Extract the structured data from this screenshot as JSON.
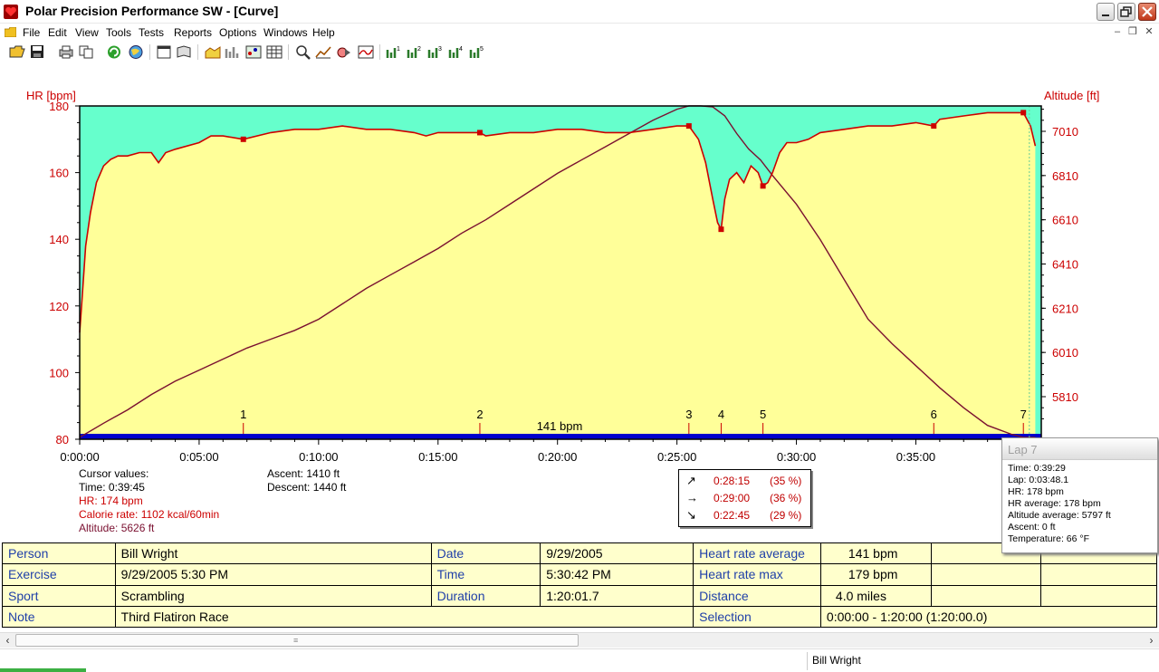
{
  "window": {
    "title": "Polar Precision Performance SW - [Curve]"
  },
  "menu": {
    "items": [
      "File",
      "Edit",
      "View",
      "Tools",
      "Tests",
      "Reports",
      "Options",
      "Windows",
      "Help"
    ]
  },
  "toolbar": {
    "icons": [
      "open-folder-icon",
      "save-icon",
      "print-icon",
      "copy-icon",
      "refresh-icon",
      "globe-icon",
      "window-icon",
      "book-icon",
      "area-chart-icon",
      "bar-chart-icon",
      "scatter-chart-icon",
      "table-grid-icon",
      "zoom-icon",
      "trend-icon",
      "compare-icon",
      "curve-icon",
      "chart-1-icon",
      "chart-2-icon",
      "chart-3-icon",
      "chart-4-icon",
      "chart-5-icon"
    ]
  },
  "chart_data": {
    "type": "line",
    "y_left_label": "HR [bpm]",
    "y_right_label": "Altitude [ft]",
    "x_ticks": [
      "0:00:00",
      "0:05:00",
      "0:10:00",
      "0:15:00",
      "0:20:00",
      "0:25:00",
      "0:30:00",
      "0:35:00"
    ],
    "y_left_ticks": [
      180,
      160,
      140,
      120,
      100,
      80
    ],
    "y_left_range": [
      80,
      180
    ],
    "y_right_ticks": [
      7010,
      6810,
      6610,
      6410,
      6210,
      6010,
      5810
    ],
    "y_right_range": [
      5626,
      7010
    ],
    "x_range_min": [
      0,
      40
    ],
    "average_label": "141 bpm",
    "laps": [
      {
        "label": "1",
        "t": 6.85,
        "hr": 170
      },
      {
        "label": "2",
        "t": 16.75,
        "hr": 172
      },
      {
        "label": "3",
        "t": 25.5,
        "hr": 174
      },
      {
        "label": "4",
        "t": 26.85,
        "hr": 143
      },
      {
        "label": "5",
        "t": 28.6,
        "hr": 156
      },
      {
        "label": "6",
        "t": 35.75,
        "hr": 174
      },
      {
        "label": "7",
        "t": 39.5,
        "hr": 178
      }
    ],
    "hr_series": {
      "name": "HR",
      "t": [
        0,
        0.1,
        0.25,
        0.45,
        0.7,
        1.0,
        1.3,
        1.6,
        2.0,
        2.5,
        3.0,
        3.3,
        3.6,
        4.0,
        5.0,
        5.5,
        6.0,
        6.85,
        8.0,
        9.0,
        10.0,
        11.0,
        12.0,
        13.0,
        14.0,
        14.5,
        15.0,
        16.0,
        16.75,
        17.0,
        18.0,
        19.0,
        20.0,
        21.0,
        22.0,
        23.0,
        24.0,
        25.0,
        25.5,
        25.9,
        26.2,
        26.5,
        26.7,
        26.85,
        27.0,
        27.2,
        27.5,
        27.8,
        28.1,
        28.4,
        28.6,
        28.8,
        29.0,
        29.3,
        29.6,
        30.0,
        30.5,
        31.0,
        32.0,
        33.0,
        34.0,
        35.0,
        35.75,
        36.0,
        37.0,
        38.0,
        39.0,
        39.5,
        39.8,
        40.0
      ],
      "hr": [
        112,
        122,
        138,
        148,
        157,
        162,
        164,
        165,
        165,
        166,
        166,
        163,
        166,
        167,
        169,
        171,
        171,
        170,
        172,
        173,
        173,
        174,
        173,
        173,
        172,
        171,
        172,
        172,
        172,
        171,
        172,
        172,
        173,
        173,
        172,
        172,
        173,
        174,
        174,
        170,
        163,
        152,
        145,
        143,
        152,
        158,
        160,
        157,
        162,
        160,
        156,
        157,
        160,
        166,
        169,
        169,
        170,
        172,
        173,
        174,
        174,
        175,
        174,
        176,
        177,
        178,
        178,
        178,
        174,
        168
      ]
    },
    "altitude_series": {
      "name": "Altitude",
      "t": [
        0,
        1,
        2,
        3,
        4,
        5,
        6,
        7,
        8,
        9,
        10,
        11,
        12,
        13,
        14,
        15,
        16,
        17,
        18,
        19,
        20,
        21,
        22,
        23,
        24,
        25,
        25.5,
        26,
        26.5,
        27,
        27.5,
        28,
        28.5,
        29,
        30,
        31,
        32,
        33,
        34,
        35,
        36,
        37,
        38,
        39,
        39.5,
        40
      ],
      "alt": [
        5626,
        5690,
        5750,
        5820,
        5880,
        5930,
        5980,
        6030,
        6070,
        6110,
        6160,
        6230,
        6300,
        6360,
        6420,
        6480,
        6550,
        6610,
        6680,
        6750,
        6820,
        6880,
        6940,
        7000,
        7060,
        7110,
        7125,
        7125,
        7120,
        7080,
        7000,
        6930,
        6880,
        6810,
        6680,
        6520,
        6340,
        6160,
        6050,
        5950,
        5850,
        5760,
        5680,
        5640,
        5626,
        5626
      ]
    }
  },
  "cursor_values": {
    "title": "Cursor values:",
    "time": "Time: 0:39:45",
    "hr": "HR: 174 bpm",
    "calorie": "Calorie rate: 1102 kcal/60min",
    "altitude": "Altitude: 5626 ft"
  },
  "ascent": {
    "ascent": "Ascent: 1410 ft",
    "descent": "Descent: 1440 ft"
  },
  "trend": {
    "rows": [
      {
        "time": "0:28:15",
        "pct": "(35 %)"
      },
      {
        "time": "0:29:00",
        "pct": "(36 %)"
      },
      {
        "time": "0:22:45",
        "pct": "(29 %)"
      }
    ]
  },
  "lap_popup": {
    "title": "Lap 7",
    "lines": [
      "Time: 0:39:29",
      "Lap: 0:03:48.1",
      "HR: 178 bpm",
      "HR average:  178 bpm",
      "Altitude average:  5797 ft",
      "Ascent:  0 ft",
      "Temperature: 66 °F"
    ]
  },
  "info": {
    "person_label": "Person",
    "person": "Bill Wright",
    "date_label": "Date",
    "date": "9/29/2005",
    "hr_avg_label": "Heart rate average",
    "hr_avg": "141 bpm",
    "exercise_label": "Exercise",
    "exercise": "9/29/2005 5:30 PM",
    "time_label": "Time",
    "time": "5:30:42 PM",
    "hr_max_label": "Heart rate max",
    "hr_max": "179 bpm",
    "sport_label": "Sport",
    "sport": "Scrambling",
    "duration_label": "Duration",
    "duration": "1:20:01.7",
    "distance_label": "Distance",
    "distance": "4.0 miles",
    "note_label": "Note",
    "note": "Third Flatiron Race",
    "selection_label": "Selection",
    "selection": "0:00:00 - 1:20:00 (1:20:00.0)"
  },
  "status": {
    "user": "Bill Wright"
  },
  "colors": {
    "hr_line": "#cc0000",
    "altitude_line": "#7a1030",
    "fill_below": "#ffff99",
    "fill_above": "#66ffcc",
    "avg_bar": "#0000cc",
    "axis_text": "#cc0000"
  }
}
